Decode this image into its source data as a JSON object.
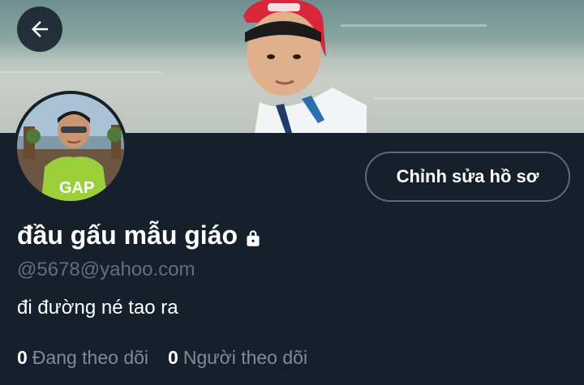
{
  "header": {
    "back_icon": "arrow-left-icon"
  },
  "profile": {
    "display_name": "đầu gấu mẫu giáo",
    "protected_icon": "lock-icon",
    "handle": "@5678@yahoo.com",
    "bio": "đi đường né tao ra",
    "edit_button_label": "Chỉnh sửa hồ sơ"
  },
  "stats": {
    "following_count": "0",
    "following_label": "Đang theo dõi",
    "followers_count": "0",
    "followers_label": "Người theo dõi"
  },
  "colors": {
    "background": "#15202b",
    "text_primary": "#ffffff",
    "text_secondary": "#5f6f7e",
    "button_border": "#5b6b7a"
  }
}
